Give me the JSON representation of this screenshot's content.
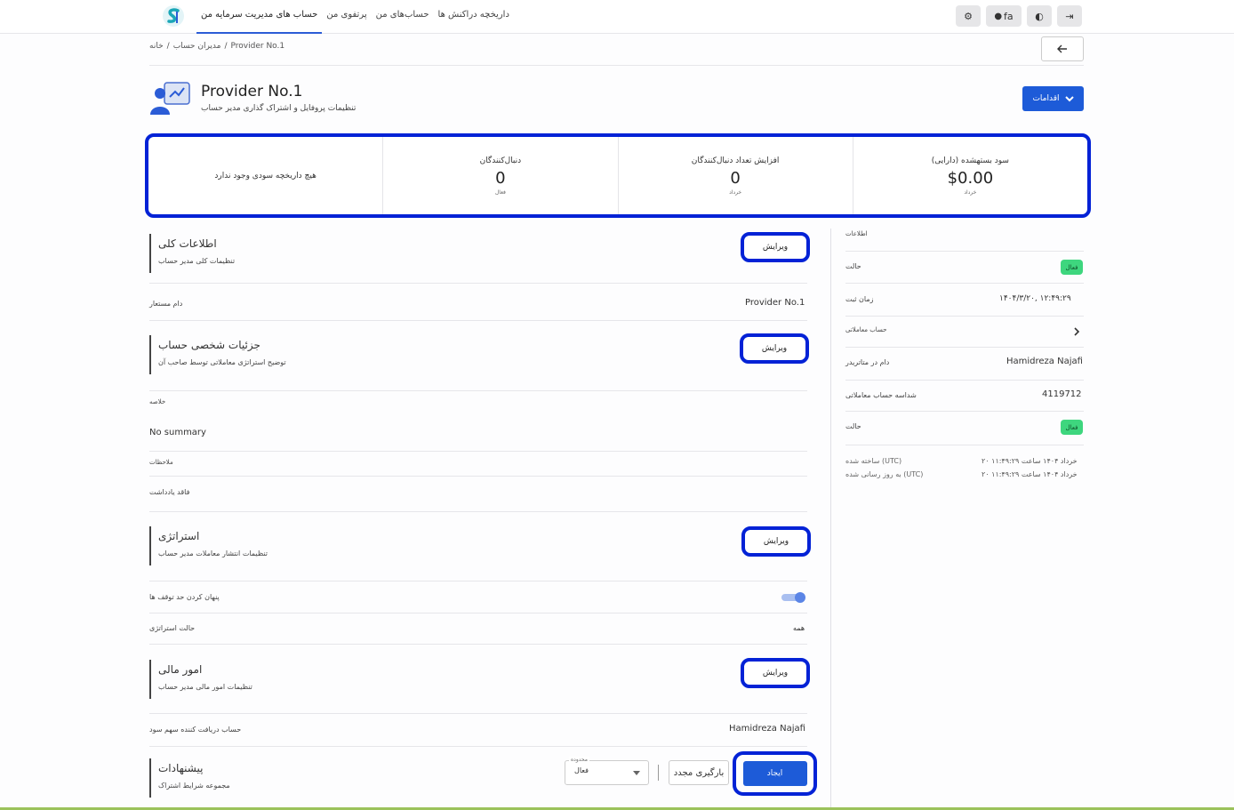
{
  "nav": {
    "items": [
      "داریخچه دراکنش ها",
      "حساب‌های من",
      "پرتفوی من",
      "حساب های مدیریت سرمایه من"
    ],
    "language": "fa"
  },
  "breadcrumb": [
    "خانه",
    "مدیران حساب",
    "Provider No.1"
  ],
  "header": {
    "title": "Provider No.1",
    "subtitle": "تنظیمات پروفایل و اشتراک گذاری مدیر حساب",
    "actions_label": "اقدامات"
  },
  "stats": {
    "profit": {
      "label": "سود بستهشده (دارایی)",
      "value": "$0.00",
      "sub": "خرداد"
    },
    "followers_increase": {
      "label": "افزایش تعداد دنبال‌کنندگان",
      "value": "0",
      "sub": "خرداد"
    },
    "followers": {
      "label": "دنبال‌کنندگان",
      "value": "0",
      "sub": "فعال"
    },
    "empty_note": "هیچ داریخچه سودی وجود ندارد"
  },
  "edit_label": "ویرایش",
  "general": {
    "title": "اطلاعات کلی",
    "subtitle": "تنظیمات کلی مدیر حساب",
    "display_name_label": "دام مستعار",
    "display_name_value": "Provider No.1"
  },
  "personal": {
    "title": "جزئیات شخصی حساب",
    "subtitle": "توضیح استراتژی معاملاتی توسط صاحب آن",
    "summary_label": "خلاصه",
    "summary_value": "No summary",
    "notes_label": "ملاحظات",
    "notes_value": "فاقد یادداشت"
  },
  "strategy": {
    "title": "استراتژی",
    "subtitle": "تنظیمات انتشار معاملات مدیر حساب",
    "hide_stop_label": "پنهان کردن حد توقف ها",
    "strategy_state_label": "حالت استراتژی",
    "strategy_state_value": "همه"
  },
  "finance": {
    "title": "امور مالی",
    "subtitle": "تنظیمات امور مالی مدیر حساب",
    "receiver_label": "حساب دریافت کننده سهم سود",
    "receiver_value": "Hamidreza Najafi"
  },
  "offers": {
    "title": "پیشنهادات",
    "subtitle": "مجموعه شرایط اشتراک",
    "filter_legend": "محدوده",
    "filter_value": "فعال",
    "reload_label": "بارگیری مجدد",
    "create_label": "ایجاد"
  },
  "sidebar": {
    "title": "اطلاعات",
    "status_label": "حالت",
    "status_badge": "فعال",
    "registered_label": "زمان ثبت",
    "registered_value": "۱۴۰۴/۳/۲۰, ۱۲:۴۹:۲۹",
    "trading_account_label": "حساب معاملاتی",
    "broker_name_label": "دام در متاتریدر",
    "broker_name_value": "Hamidreza Najafi",
    "account_id_label": "شداسه حساب معاملاتی",
    "account_id_value": "4119712",
    "status2_label": "حالت",
    "status2_badge": "فعال",
    "created_label": "ساخته شده (UTC)",
    "created_value": "۲۰ خرداد ۱۴۰۴ ساعت ۱۱:۴۹:۲۹",
    "updated_label": "به روز رسانی شده (UTC)",
    "updated_value": "۲۰ خرداد ۱۴۰۴ ساعت ۱۱:۴۹:۲۹"
  },
  "colors": {
    "accent": "#1d5bd8",
    "highlight": "#0322d6",
    "success": "#3ed67e"
  }
}
